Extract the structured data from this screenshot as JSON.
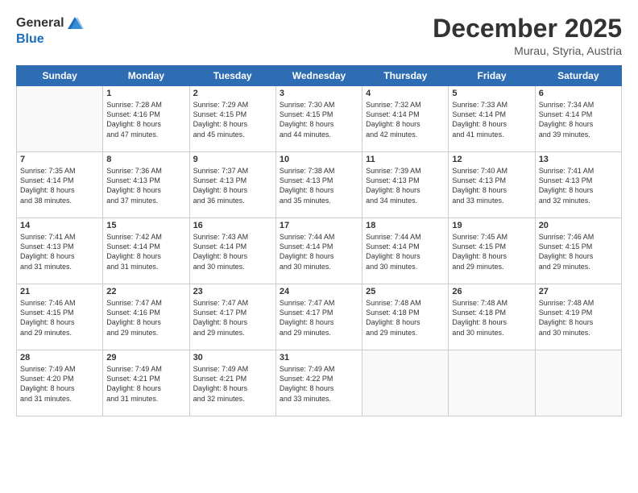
{
  "logo": {
    "general": "General",
    "blue": "Blue"
  },
  "header": {
    "month": "December 2025",
    "location": "Murau, Styria, Austria"
  },
  "weekdays": [
    "Sunday",
    "Monday",
    "Tuesday",
    "Wednesday",
    "Thursday",
    "Friday",
    "Saturday"
  ],
  "weeks": [
    [
      {
        "day": "",
        "info": ""
      },
      {
        "day": "1",
        "info": "Sunrise: 7:28 AM\nSunset: 4:16 PM\nDaylight: 8 hours\nand 47 minutes."
      },
      {
        "day": "2",
        "info": "Sunrise: 7:29 AM\nSunset: 4:15 PM\nDaylight: 8 hours\nand 45 minutes."
      },
      {
        "day": "3",
        "info": "Sunrise: 7:30 AM\nSunset: 4:15 PM\nDaylight: 8 hours\nand 44 minutes."
      },
      {
        "day": "4",
        "info": "Sunrise: 7:32 AM\nSunset: 4:14 PM\nDaylight: 8 hours\nand 42 minutes."
      },
      {
        "day": "5",
        "info": "Sunrise: 7:33 AM\nSunset: 4:14 PM\nDaylight: 8 hours\nand 41 minutes."
      },
      {
        "day": "6",
        "info": "Sunrise: 7:34 AM\nSunset: 4:14 PM\nDaylight: 8 hours\nand 39 minutes."
      }
    ],
    [
      {
        "day": "7",
        "info": "Sunrise: 7:35 AM\nSunset: 4:14 PM\nDaylight: 8 hours\nand 38 minutes."
      },
      {
        "day": "8",
        "info": "Sunrise: 7:36 AM\nSunset: 4:13 PM\nDaylight: 8 hours\nand 37 minutes."
      },
      {
        "day": "9",
        "info": "Sunrise: 7:37 AM\nSunset: 4:13 PM\nDaylight: 8 hours\nand 36 minutes."
      },
      {
        "day": "10",
        "info": "Sunrise: 7:38 AM\nSunset: 4:13 PM\nDaylight: 8 hours\nand 35 minutes."
      },
      {
        "day": "11",
        "info": "Sunrise: 7:39 AM\nSunset: 4:13 PM\nDaylight: 8 hours\nand 34 minutes."
      },
      {
        "day": "12",
        "info": "Sunrise: 7:40 AM\nSunset: 4:13 PM\nDaylight: 8 hours\nand 33 minutes."
      },
      {
        "day": "13",
        "info": "Sunrise: 7:41 AM\nSunset: 4:13 PM\nDaylight: 8 hours\nand 32 minutes."
      }
    ],
    [
      {
        "day": "14",
        "info": "Sunrise: 7:41 AM\nSunset: 4:13 PM\nDaylight: 8 hours\nand 31 minutes."
      },
      {
        "day": "15",
        "info": "Sunrise: 7:42 AM\nSunset: 4:14 PM\nDaylight: 8 hours\nand 31 minutes."
      },
      {
        "day": "16",
        "info": "Sunrise: 7:43 AM\nSunset: 4:14 PM\nDaylight: 8 hours\nand 30 minutes."
      },
      {
        "day": "17",
        "info": "Sunrise: 7:44 AM\nSunset: 4:14 PM\nDaylight: 8 hours\nand 30 minutes."
      },
      {
        "day": "18",
        "info": "Sunrise: 7:44 AM\nSunset: 4:14 PM\nDaylight: 8 hours\nand 30 minutes."
      },
      {
        "day": "19",
        "info": "Sunrise: 7:45 AM\nSunset: 4:15 PM\nDaylight: 8 hours\nand 29 minutes."
      },
      {
        "day": "20",
        "info": "Sunrise: 7:46 AM\nSunset: 4:15 PM\nDaylight: 8 hours\nand 29 minutes."
      }
    ],
    [
      {
        "day": "21",
        "info": "Sunrise: 7:46 AM\nSunset: 4:15 PM\nDaylight: 8 hours\nand 29 minutes."
      },
      {
        "day": "22",
        "info": "Sunrise: 7:47 AM\nSunset: 4:16 PM\nDaylight: 8 hours\nand 29 minutes."
      },
      {
        "day": "23",
        "info": "Sunrise: 7:47 AM\nSunset: 4:17 PM\nDaylight: 8 hours\nand 29 minutes."
      },
      {
        "day": "24",
        "info": "Sunrise: 7:47 AM\nSunset: 4:17 PM\nDaylight: 8 hours\nand 29 minutes."
      },
      {
        "day": "25",
        "info": "Sunrise: 7:48 AM\nSunset: 4:18 PM\nDaylight: 8 hours\nand 29 minutes."
      },
      {
        "day": "26",
        "info": "Sunrise: 7:48 AM\nSunset: 4:18 PM\nDaylight: 8 hours\nand 30 minutes."
      },
      {
        "day": "27",
        "info": "Sunrise: 7:48 AM\nSunset: 4:19 PM\nDaylight: 8 hours\nand 30 minutes."
      }
    ],
    [
      {
        "day": "28",
        "info": "Sunrise: 7:49 AM\nSunset: 4:20 PM\nDaylight: 8 hours\nand 31 minutes."
      },
      {
        "day": "29",
        "info": "Sunrise: 7:49 AM\nSunset: 4:21 PM\nDaylight: 8 hours\nand 31 minutes."
      },
      {
        "day": "30",
        "info": "Sunrise: 7:49 AM\nSunset: 4:21 PM\nDaylight: 8 hours\nand 32 minutes."
      },
      {
        "day": "31",
        "info": "Sunrise: 7:49 AM\nSunset: 4:22 PM\nDaylight: 8 hours\nand 33 minutes."
      },
      {
        "day": "",
        "info": ""
      },
      {
        "day": "",
        "info": ""
      },
      {
        "day": "",
        "info": ""
      }
    ]
  ]
}
